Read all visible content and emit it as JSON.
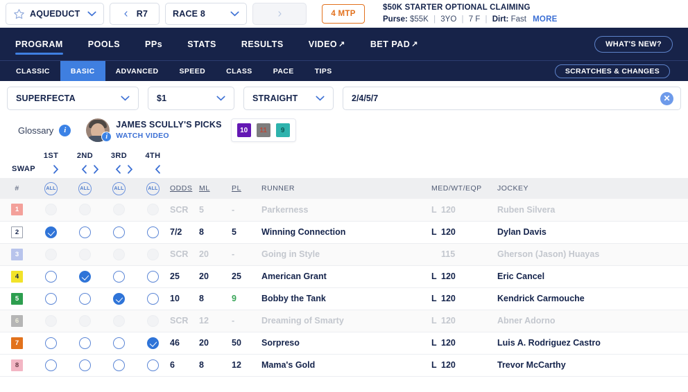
{
  "topbar": {
    "track": "AQUEDUCT",
    "prev_race": "R7",
    "race": "RACE 8",
    "next_race": "",
    "mtp": "4 MTP",
    "race_title": "$50K STARTER OPTIONAL CLAIMING",
    "purse_label": "Purse:",
    "purse_value": "$55K",
    "age": "3YO",
    "distance": "7 F",
    "surface_label": "Dirt:",
    "surface_value": "Fast",
    "more": "MORE",
    "star_icon": "star-outline-icon",
    "prev_icon": "chevron-left-icon",
    "next_icon": "chevron-right-icon",
    "dropdown_icon": "chevron-down-icon"
  },
  "nav": {
    "items": [
      {
        "label": "PROGRAM",
        "external": false,
        "active": true
      },
      {
        "label": "POOLS",
        "external": false,
        "active": false
      },
      {
        "label": "PPs",
        "external": false,
        "active": false
      },
      {
        "label": "STATS",
        "external": false,
        "active": false
      },
      {
        "label": "RESULTS",
        "external": false,
        "active": false
      },
      {
        "label": "VIDEO",
        "external": true,
        "active": false
      },
      {
        "label": "BET PAD",
        "external": true,
        "active": false
      }
    ],
    "whats_new": "WHAT'S NEW?"
  },
  "subnav": {
    "items": [
      {
        "label": "CLASSIC",
        "active": false
      },
      {
        "label": "BASIC",
        "active": true
      },
      {
        "label": "ADVANCED",
        "active": false
      },
      {
        "label": "SPEED",
        "active": false
      },
      {
        "label": "CLASS",
        "active": false
      },
      {
        "label": "PACE",
        "active": false
      },
      {
        "label": "TIPS",
        "active": false
      }
    ],
    "scratches": "SCRATCHES & CHANGES"
  },
  "betbar": {
    "bet_type": "SUPERFECTA",
    "amount": "$1",
    "format": "STRAIGHT",
    "entry_value": "2/4/5/7",
    "entry_placeholder": "",
    "clear_icon": "close-circle-icon"
  },
  "picks": {
    "glossary": "Glossary",
    "info_icon": "info-icon",
    "title": "JAMES SCULLY'S PICKS",
    "link": "WATCH VIDEO",
    "avatar_icon": "handicapper-avatar",
    "badges": [
      {
        "num": "10",
        "color": "#6418b4",
        "text": "#ffffff"
      },
      {
        "num": "11",
        "color": "#7e7e7e",
        "text": "#b84a3a"
      },
      {
        "num": "9",
        "color": "#2eb3ad",
        "text": "#0d5a57"
      }
    ]
  },
  "swap": {
    "label": "SWAP",
    "positions": [
      "1ST",
      "2ND",
      "3RD",
      "4TH"
    ],
    "arrows": [
      {
        "left": false,
        "right": true
      },
      {
        "left": true,
        "right": true
      },
      {
        "left": true,
        "right": true
      },
      {
        "left": true,
        "right": false
      }
    ],
    "left_icon": "chevron-left-icon",
    "right_icon": "chevron-right-icon"
  },
  "table": {
    "headers": {
      "num": "#",
      "all": "ALL",
      "odds": "ODDS",
      "ml": "ML",
      "pl": "PL",
      "runner": "RUNNER",
      "med": "MED/WT/EQP",
      "jockey": "JOCKEY"
    },
    "rows": [
      {
        "num": "1",
        "saddle_bg": "#f3a09a",
        "saddle_fg": "#ffffff",
        "saddle_border": "",
        "scratched": true,
        "selections": [
          false,
          false,
          false,
          false
        ],
        "odds": "SCR",
        "ml": "5",
        "pl": "-",
        "pl_green": false,
        "runner": "Parkerness",
        "med": "L",
        "wt": "120",
        "jockey": "Ruben Silvera"
      },
      {
        "num": "2",
        "saddle_bg": "#ffffff",
        "saddle_fg": "#14234b",
        "saddle_border": "#9aa0ad",
        "scratched": false,
        "selections": [
          true,
          false,
          false,
          false
        ],
        "odds": "7/2",
        "ml": "8",
        "pl": "5",
        "pl_green": false,
        "runner": "Winning Connection",
        "med": "L",
        "wt": "120",
        "jockey": "Dylan Davis"
      },
      {
        "num": "3",
        "saddle_bg": "#b8c4ec",
        "saddle_fg": "#ffffff",
        "saddle_border": "",
        "scratched": true,
        "selections": [
          false,
          false,
          false,
          false
        ],
        "odds": "SCR",
        "ml": "20",
        "pl": "-",
        "pl_green": false,
        "runner": "Going in Style",
        "med": "",
        "wt": "115",
        "jockey": "Gherson (Jason) Huayas"
      },
      {
        "num": "4",
        "saddle_bg": "#f2e32a",
        "saddle_fg": "#14234b",
        "saddle_border": "",
        "scratched": false,
        "selections": [
          false,
          true,
          false,
          false
        ],
        "odds": "25",
        "ml": "20",
        "pl": "25",
        "pl_green": false,
        "runner": "American Grant",
        "med": "L",
        "wt": "120",
        "jockey": "Eric Cancel"
      },
      {
        "num": "5",
        "saddle_bg": "#2d9e4f",
        "saddle_fg": "#ffffff",
        "saddle_border": "",
        "scratched": false,
        "selections": [
          false,
          false,
          true,
          false
        ],
        "odds": "10",
        "ml": "8",
        "pl": "9",
        "pl_green": true,
        "runner": "Bobby the Tank",
        "med": "L",
        "wt": "120",
        "jockey": "Kendrick Carmouche"
      },
      {
        "num": "6",
        "saddle_bg": "#b5b5b5",
        "saddle_fg": "#ebebd8",
        "saddle_border": "",
        "scratched": true,
        "selections": [
          false,
          false,
          false,
          false
        ],
        "odds": "SCR",
        "ml": "12",
        "pl": "-",
        "pl_green": false,
        "runner": "Dreaming of Smarty",
        "med": "L",
        "wt": "120",
        "jockey": "Abner Adorno"
      },
      {
        "num": "7",
        "saddle_bg": "#e2721c",
        "saddle_fg": "#ffffff",
        "saddle_border": "",
        "scratched": false,
        "selections": [
          false,
          false,
          false,
          true
        ],
        "odds": "46",
        "ml": "20",
        "pl": "50",
        "pl_green": false,
        "runner": "Sorpreso",
        "med": "L",
        "wt": "120",
        "jockey": "Luis A. Rodriguez Castro"
      },
      {
        "num": "8",
        "saddle_bg": "#f3b6c4",
        "saddle_fg": "#6b3a46",
        "saddle_border": "",
        "scratched": false,
        "selections": [
          false,
          false,
          false,
          false
        ],
        "odds": "6",
        "ml": "8",
        "pl": "12",
        "pl_green": false,
        "runner": "Mama's Gold",
        "med": "L",
        "wt": "120",
        "jockey": "Trevor McCarthy"
      }
    ]
  }
}
